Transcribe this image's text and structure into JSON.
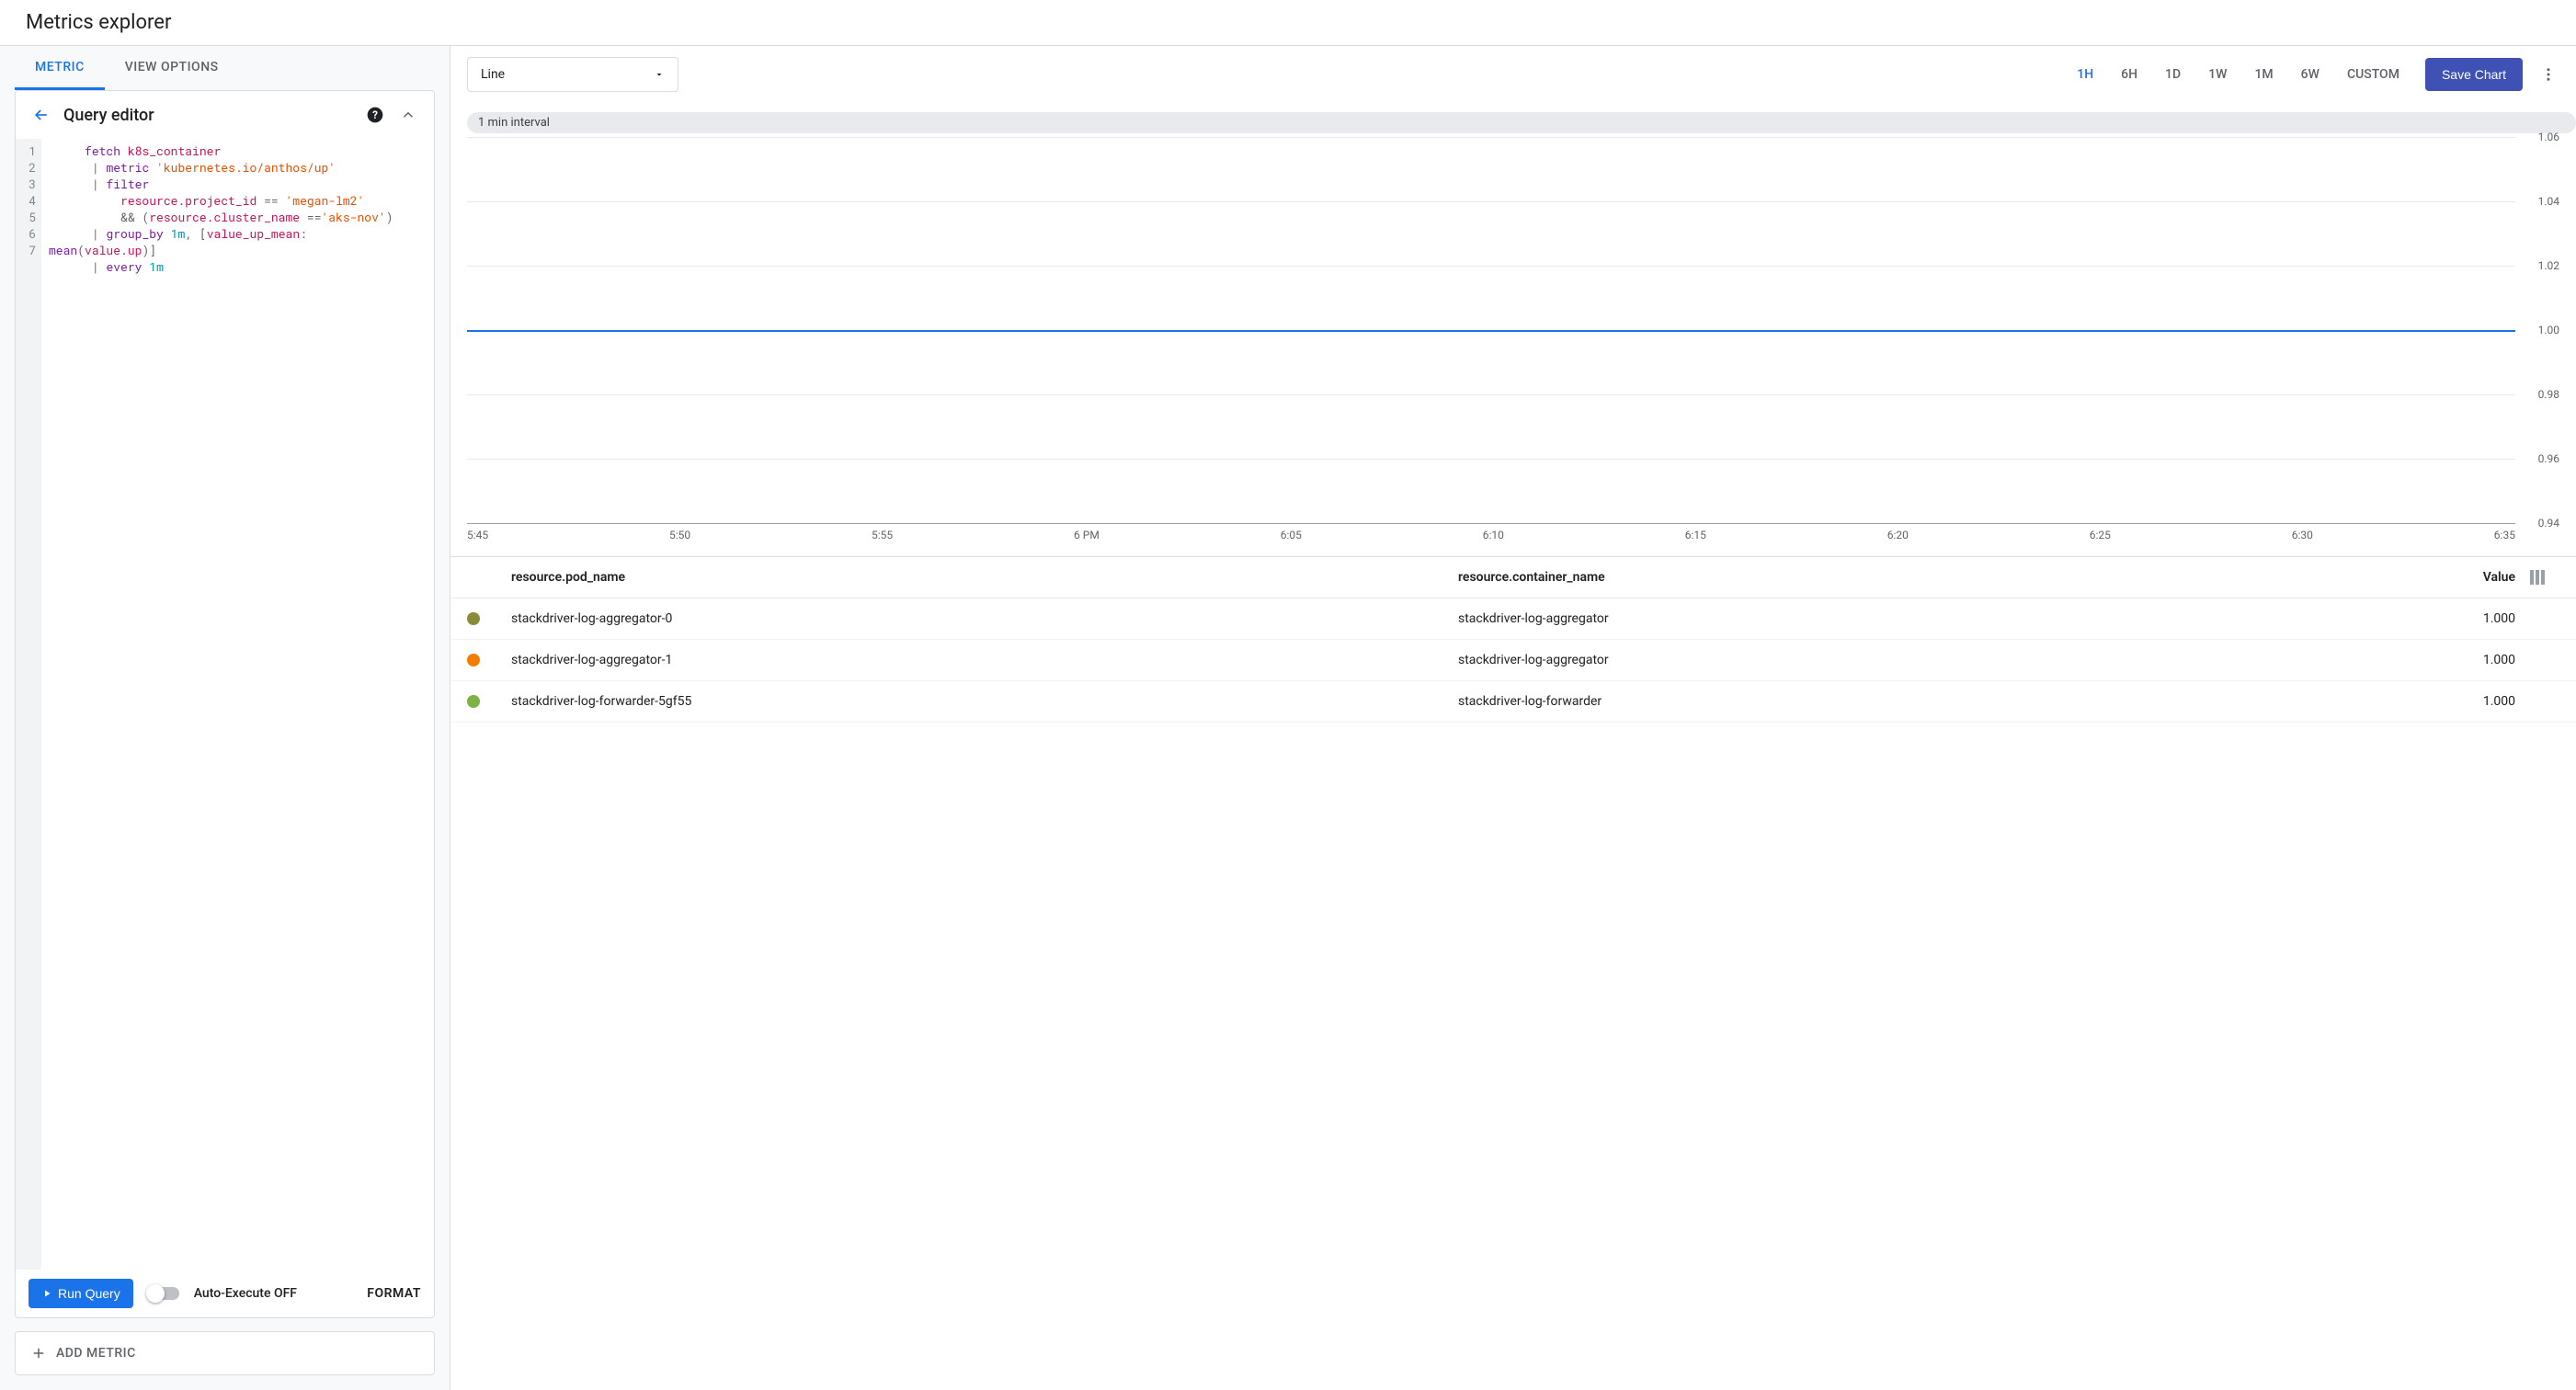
{
  "title": "Metrics explorer",
  "tabs": {
    "metric": "METRIC",
    "viewOptions": "VIEW OPTIONS"
  },
  "panel": {
    "title": "Query editor",
    "run": "Run Query",
    "autoExec": "Auto-Execute OFF",
    "format": "FORMAT"
  },
  "editor": {
    "lineCount": 7,
    "lines": [
      [
        [
          "sp",
          "     "
        ],
        [
          "kw",
          "fetch"
        ],
        [
          "sp",
          " "
        ],
        [
          "id",
          "k8s_container"
        ]
      ],
      [
        [
          "sp",
          "      "
        ],
        [
          "pun",
          "|"
        ],
        [
          "sp",
          " "
        ],
        [
          "kw",
          "metric"
        ],
        [
          "sp",
          " "
        ],
        [
          "str",
          "'kubernetes.io/anthos/up'"
        ]
      ],
      [
        [
          "sp",
          "      "
        ],
        [
          "pun",
          "|"
        ],
        [
          "sp",
          " "
        ],
        [
          "kw",
          "filter"
        ]
      ],
      [
        [
          "sp",
          "          "
        ],
        [
          "id",
          "resource.project_id"
        ],
        [
          "sp",
          " "
        ],
        [
          "pun",
          "=="
        ],
        [
          "sp",
          " "
        ],
        [
          "str",
          "'megan-lm2'"
        ]
      ],
      [
        [
          "sp",
          "          "
        ],
        [
          "pun",
          "&&"
        ],
        [
          "sp",
          " "
        ],
        [
          "pun",
          "("
        ],
        [
          "id",
          "resource.cluster_name"
        ],
        [
          "sp",
          " "
        ],
        [
          "pun",
          "=="
        ],
        [
          "str",
          "'aks-nov'"
        ],
        [
          "pun",
          ")"
        ]
      ],
      [
        [
          "sp",
          "      "
        ],
        [
          "pun",
          "|"
        ],
        [
          "sp",
          " "
        ],
        [
          "kw",
          "group_by"
        ],
        [
          "sp",
          " "
        ],
        [
          "num",
          "1m"
        ],
        [
          "pun",
          ","
        ],
        [
          "sp",
          " "
        ],
        [
          "pun",
          "["
        ],
        [
          "id",
          "value_up_mean"
        ],
        [
          "pun",
          ":"
        ],
        [
          "sp",
          " "
        ],
        [
          "br",
          ""
        ],
        [
          "kw",
          "mean"
        ],
        [
          "pun",
          "("
        ],
        [
          "id",
          "value.up"
        ],
        [
          "pun",
          ")"
        ],
        [
          "pun",
          "]"
        ]
      ],
      [
        [
          "sp",
          "      "
        ],
        [
          "pun",
          "|"
        ],
        [
          "sp",
          " "
        ],
        [
          "kw",
          "every"
        ],
        [
          "sp",
          " "
        ],
        [
          "num",
          "1m"
        ]
      ]
    ]
  },
  "addMetric": "ADD METRIC",
  "toolbar": {
    "chartType": "Line",
    "ranges": [
      "1H",
      "6H",
      "1D",
      "1W",
      "1M",
      "6W",
      "CUSTOM"
    ],
    "activeRange": "1H",
    "save": "Save Chart"
  },
  "chart": {
    "interval": "1 min interval",
    "yLabels": [
      "1.06",
      "1.04",
      "1.02",
      "1.00",
      "0.98",
      "0.96",
      "0.94"
    ],
    "xLabels": [
      "5:45",
      "5:50",
      "5:55",
      "6 PM",
      "6:05",
      "6:10",
      "6:15",
      "6:20",
      "6:25",
      "6:30",
      "6:35"
    ]
  },
  "chart_data": {
    "type": "line",
    "title": "",
    "xlabel": "",
    "ylabel": "",
    "ylim": [
      0.94,
      1.06
    ],
    "x": [
      "5:45",
      "5:50",
      "5:55",
      "6 PM",
      "6:05",
      "6:10",
      "6:15",
      "6:20",
      "6:25",
      "6:30",
      "6:35"
    ],
    "series": [
      {
        "name": "stackdriver-log-aggregator-0",
        "values": [
          1.0,
          1.0,
          1.0,
          1.0,
          1.0,
          1.0,
          1.0,
          1.0,
          1.0,
          1.0,
          1.0
        ]
      },
      {
        "name": "stackdriver-log-aggregator-1",
        "values": [
          1.0,
          1.0,
          1.0,
          1.0,
          1.0,
          1.0,
          1.0,
          1.0,
          1.0,
          1.0,
          1.0
        ]
      },
      {
        "name": "stackdriver-log-forwarder-5gf55",
        "values": [
          1.0,
          1.0,
          1.0,
          1.0,
          1.0,
          1.0,
          1.0,
          1.0,
          1.0,
          1.0,
          1.0
        ]
      }
    ]
  },
  "table": {
    "headers": {
      "pod": "resource.pod_name",
      "container": "resource.container_name",
      "value": "Value"
    },
    "rows": [
      {
        "color": "#8a8c3a",
        "pod": "stackdriver-log-aggregator-0",
        "container": "stackdriver-log-aggregator",
        "value": "1.000"
      },
      {
        "color": "#f57c00",
        "pod": "stackdriver-log-aggregator-1",
        "container": "stackdriver-log-aggregator",
        "value": "1.000"
      },
      {
        "color": "#7cb342",
        "pod": "stackdriver-log-forwarder-5gf55",
        "container": "stackdriver-log-forwarder",
        "value": "1.000"
      }
    ]
  }
}
